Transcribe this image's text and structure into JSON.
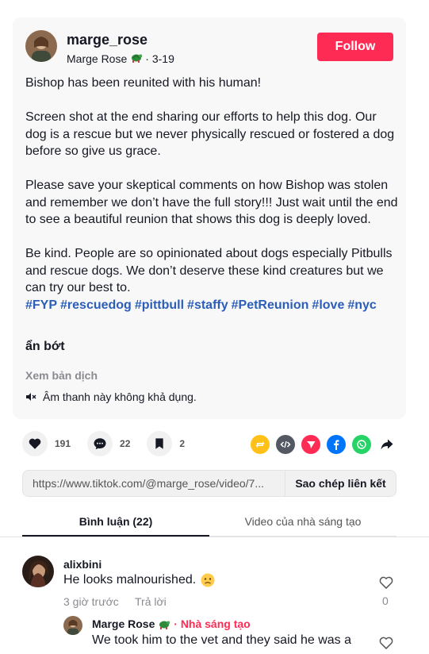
{
  "post": {
    "username": "marge_rose",
    "display_name": "Marge Rose",
    "display_emoji": "turtle-emoji",
    "date": "3-19",
    "follow_label": "Follow",
    "caption_p1": "Bishop has been reunited with his human!",
    "caption_p2": "Screen shot at the end sharing our efforts to help this dog. Our dog is a rescue but we never physically rescued or fostered a dog before so give us grace.",
    "caption_p3": "Please save your skeptical comments on how Bishop was stolen and remember we don’t have the full story!!! Just wait until the end to see a beautiful reunion that shows this dog is deeply loved.",
    "caption_p4": "Be kind. People are so opinionated about dogs especially Pitbulls and rescue dogs. We don’t deserve these kind creatures but we can try our best to.",
    "hashtags": [
      "#FYP",
      "#rescuedog",
      "#pittbull",
      "#staffy",
      "#PetReunion",
      "#love",
      "#nyc"
    ],
    "see_less": "ẩn bớt",
    "translate": "Xem bản dịch",
    "audio_status": "Âm thanh này không khả dụng."
  },
  "actions": {
    "likes": "191",
    "comments": "22",
    "saves": "2",
    "share_icons": [
      "repost-icon",
      "embed-icon",
      "send-icon",
      "facebook-icon",
      "whatsapp-icon",
      "share-arrow-icon"
    ]
  },
  "link": {
    "url": "https://www.tiktok.com/@marge_rose/video/7...",
    "copy_label": "Sao chép liên kết"
  },
  "tabs": {
    "comments": "Bình luận (22)",
    "creator_videos": "Video của nhà sáng tạo"
  },
  "comments": [
    {
      "user": "alixbini",
      "text": "He looks malnourished.",
      "emoji": "worried-face-emoji",
      "time": "3 giờ trước",
      "reply_label": "Trả lời",
      "likes": "0"
    }
  ],
  "reply": {
    "user": "Marge Rose",
    "emoji": "turtle-emoji",
    "separator": " · ",
    "creator_label": "Nhà sáng tạo",
    "text": "We took him to the vet and they said he was a"
  },
  "colors": {
    "accent": "#fe2c55",
    "hashtag": "#2b5db9",
    "muted": "#8a8b91",
    "card_bg": "#f8f8f8"
  }
}
